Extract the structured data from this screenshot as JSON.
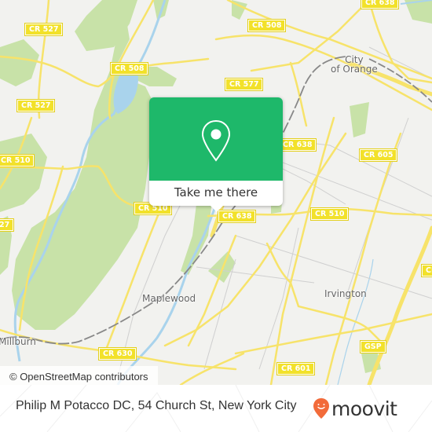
{
  "map": {
    "colors": {
      "background": "#f2f2ef",
      "park": "#c8e2a8",
      "water": "#a9d3ec",
      "road": "#f7e36a",
      "minor_road": "#c8c8c8",
      "rail": "#888888",
      "label_bg": "#f2e12a",
      "place_text": "#666666"
    },
    "road_labels": [
      {
        "id": "cr527-top",
        "text": "CR 527"
      },
      {
        "id": "cr508-left",
        "text": "CR 508"
      },
      {
        "id": "cr508-top",
        "text": "CR 508"
      },
      {
        "id": "cr638-top",
        "text": "CR 638"
      },
      {
        "id": "cr527-left",
        "text": "CR 527"
      },
      {
        "id": "cr577",
        "text": "CR 577"
      },
      {
        "id": "cr510-left",
        "text": "CR 510"
      },
      {
        "id": "cr638-mid",
        "text": "CR 638"
      },
      {
        "id": "cr605",
        "text": "CR 605"
      },
      {
        "id": "cr510-mid",
        "text": "CR 510"
      },
      {
        "id": "cr638-bottom",
        "text": "CR 638"
      },
      {
        "id": "cr510-right",
        "text": "CR 510"
      },
      {
        "id": "cr527-edge",
        "text": "27"
      },
      {
        "id": "cr630",
        "text": "CR 630"
      },
      {
        "id": "cr601",
        "text": "CR 601"
      },
      {
        "id": "gsp",
        "text": "GSP"
      },
      {
        "id": "cr-right-edge",
        "text": "CR"
      }
    ],
    "place_labels": [
      {
        "id": "city-of-orange",
        "text": "City\nof Orange"
      },
      {
        "id": "maplewood",
        "text": "Maplewood"
      },
      {
        "id": "irvington",
        "text": "Irvington"
      },
      {
        "id": "millburn",
        "text": "Millburn"
      }
    ],
    "attribution": "© OpenStreetMap contributors"
  },
  "popup": {
    "icon": "map-pin-icon",
    "button_label": "Take me there",
    "accent_color": "#1eb86a"
  },
  "footer": {
    "address": "Philip M Potacco DC, 54 Church St, New York City",
    "logo_text": "moovit",
    "logo_icon": "moovit-pin-icon",
    "logo_color": "#f26b3a"
  }
}
